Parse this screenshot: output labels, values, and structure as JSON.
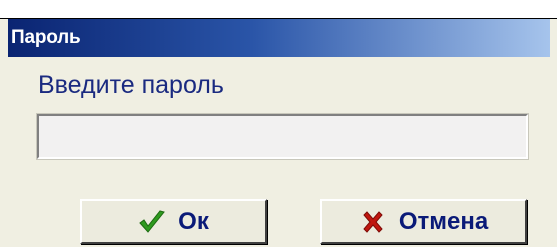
{
  "dialog": {
    "title": "Пароль",
    "prompt": "Введите пароль",
    "password_value": "",
    "ok_label": "Ок",
    "cancel_label": "Отмена"
  },
  "icons": {
    "ok": "checkmark-icon",
    "cancel": "cross-icon"
  },
  "colors": {
    "title_bar_start": "#0a2472",
    "title_bar_end": "#a6c4ec",
    "dialog_background": "#f0efe2",
    "text_color": "#1a2a80",
    "ok_icon_color": "#2e9a1e",
    "cancel_icon_color": "#c0160f"
  }
}
